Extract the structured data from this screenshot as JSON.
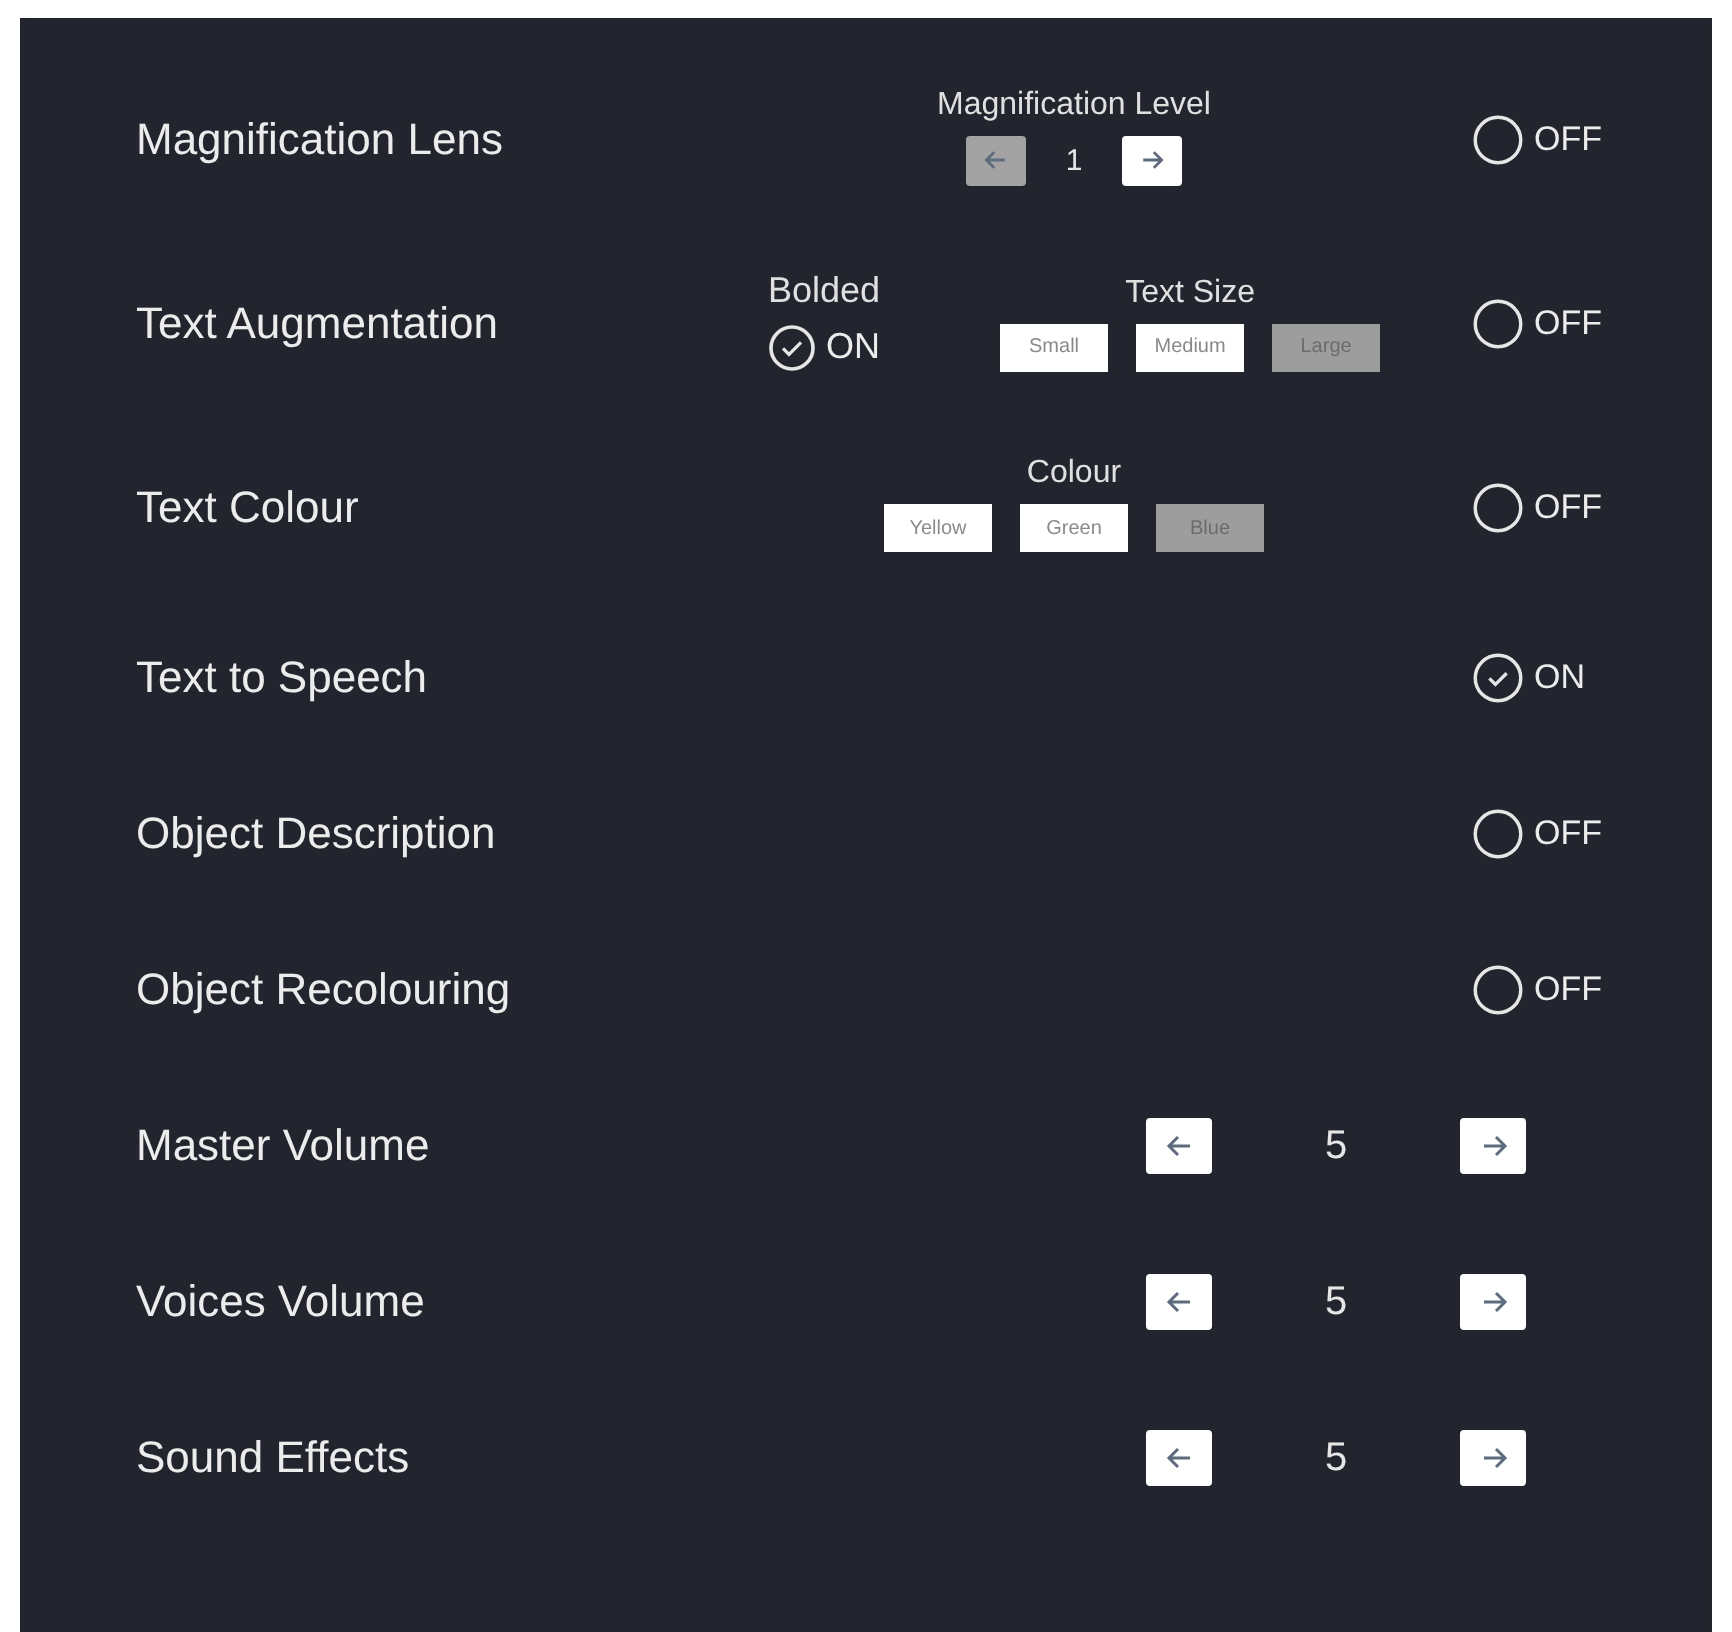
{
  "settings": [
    {
      "kind": "toggle",
      "label": "Magnification Lens",
      "toggle": {
        "checked": false,
        "text": "OFF"
      },
      "extras": [
        {
          "kind": "stepper",
          "title": "Magnification Level",
          "value": "1",
          "prev_disabled": true,
          "next_disabled": false
        }
      ]
    },
    {
      "kind": "toggle",
      "label": "Text Augmentation",
      "toggle": {
        "checked": false,
        "text": "OFF"
      },
      "extras": [
        {
          "kind": "check",
          "title": "Bolded",
          "checked": true,
          "text": "ON"
        },
        {
          "kind": "options",
          "title": "Text Size",
          "options": [
            {
              "label": "Small",
              "selected": false
            },
            {
              "label": "Medium",
              "selected": false
            },
            {
              "label": "Large",
              "selected": true
            }
          ]
        }
      ]
    },
    {
      "kind": "toggle",
      "label": "Text Colour",
      "toggle": {
        "checked": false,
        "text": "OFF"
      },
      "extras": [
        {
          "kind": "options",
          "title": "Colour",
          "options": [
            {
              "label": "Yellow",
              "selected": false
            },
            {
              "label": "Green",
              "selected": false
            },
            {
              "label": "Blue",
              "selected": true
            }
          ]
        }
      ]
    },
    {
      "kind": "toggle",
      "label": "Text to Speech",
      "toggle": {
        "checked": true,
        "text": "ON"
      }
    },
    {
      "kind": "toggle",
      "label": "Object Description",
      "toggle": {
        "checked": false,
        "text": "OFF"
      }
    },
    {
      "kind": "toggle",
      "label": "Object Recolouring",
      "toggle": {
        "checked": false,
        "text": "OFF"
      }
    },
    {
      "kind": "volume",
      "label": "Master Volume",
      "value": "5"
    },
    {
      "kind": "volume",
      "label": "Voices Volume",
      "value": "5"
    },
    {
      "kind": "volume",
      "label": "Sound Effects",
      "value": "5"
    }
  ]
}
